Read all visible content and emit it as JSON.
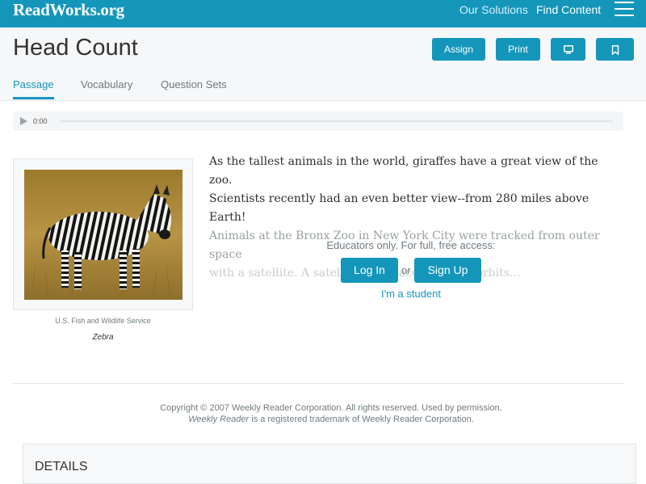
{
  "topbar": {
    "logo": "ReadWorks.org",
    "nav": {
      "solutions": "Our Solutions",
      "find_content": "Find Content"
    }
  },
  "header": {
    "title": "Head Count",
    "buttons": {
      "assign": "Assign",
      "print": "Print"
    },
    "icons": {
      "present": "monitor-icon",
      "bookmark": "bookmark-icon"
    },
    "tabs": [
      "Passage",
      "Vocabulary",
      "Question Sets"
    ],
    "active_tab": "Passage"
  },
  "audio": {
    "time": "0:00",
    "progress": 0
  },
  "image": {
    "credit": "U.S. Fish and Wildlife Service",
    "caption": "Zebra"
  },
  "passage": {
    "line1": "As the tallest animals in the world, giraffes have a great view of the zoo.",
    "line2": "Scientists recently had an even better view--from 280 miles above Earth!",
    "line3": "Animals at the Bronx Zoo in New York City were tracked from outer space",
    "line4": "with a satellite. A satellite is a spacecraft that orbits..."
  },
  "access": {
    "prompt": "Educators only. For full, free access:",
    "login": "Log In",
    "or": "or",
    "signup": "Sign Up",
    "student": "I'm a student"
  },
  "footer": {
    "copyright": "Copyright © 2007 Weekly Reader Corporation. All rights reserved. Used by permission.",
    "trademark_brand": "Weekly Reader",
    "trademark_rest": " is a registered trademark of Weekly Reader Corporation."
  },
  "details": {
    "title": "DETAILS"
  },
  "colors": {
    "brand": "#1496bb",
    "header_bg": "#f5f7f8",
    "muted": "#6f7a80"
  }
}
